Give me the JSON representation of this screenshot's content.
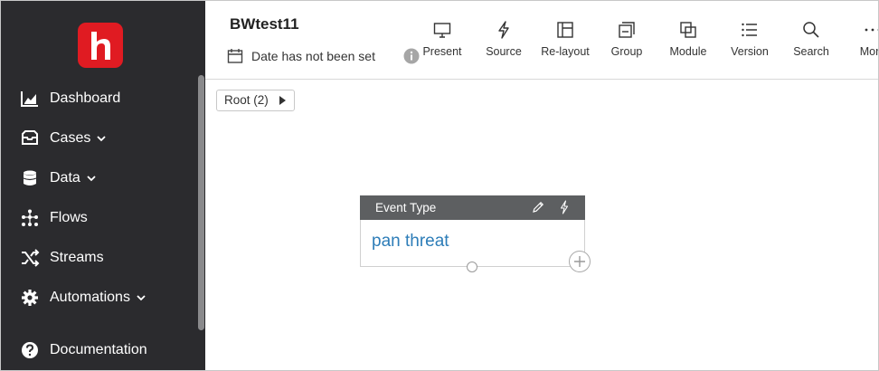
{
  "sidebar": {
    "logo_icon": "h-logo-icon",
    "items": [
      {
        "label": "Dashboard",
        "icon": "chart-icon",
        "chevron": false
      },
      {
        "label": "Cases",
        "icon": "inbox-icon",
        "chevron": true
      },
      {
        "label": "Data",
        "icon": "database-icon",
        "chevron": true
      },
      {
        "label": "Flows",
        "icon": "flows-icon",
        "chevron": false
      },
      {
        "label": "Streams",
        "icon": "shuffle-icon",
        "chevron": false
      },
      {
        "label": "Automations",
        "icon": "gear-icon",
        "chevron": true
      },
      {
        "label": "Documentation",
        "icon": "help-icon",
        "chevron": false
      }
    ]
  },
  "header": {
    "title": "BWtest11",
    "date_text": "Date has not been set",
    "toolbar": [
      {
        "label": "Present",
        "icon": "monitor-icon"
      },
      {
        "label": "Source",
        "icon": "lightning-icon"
      },
      {
        "label": "Re-layout",
        "icon": "layout-icon"
      },
      {
        "label": "Group",
        "icon": "group-icon"
      },
      {
        "label": "Module",
        "icon": "module-icon"
      },
      {
        "label": "Version",
        "icon": "list-icon"
      },
      {
        "label": "Search",
        "icon": "search-icon"
      },
      {
        "label": "More",
        "icon": "more-icon"
      }
    ]
  },
  "canvas": {
    "breadcrumb": "Root (2)",
    "node": {
      "title": "Event Type",
      "value": "pan threat"
    }
  },
  "colors": {
    "sidebar_bg": "#2b2b2e",
    "brand_red": "#e01b22",
    "node_header": "#5d5f61",
    "link_blue": "#2d7db8"
  }
}
